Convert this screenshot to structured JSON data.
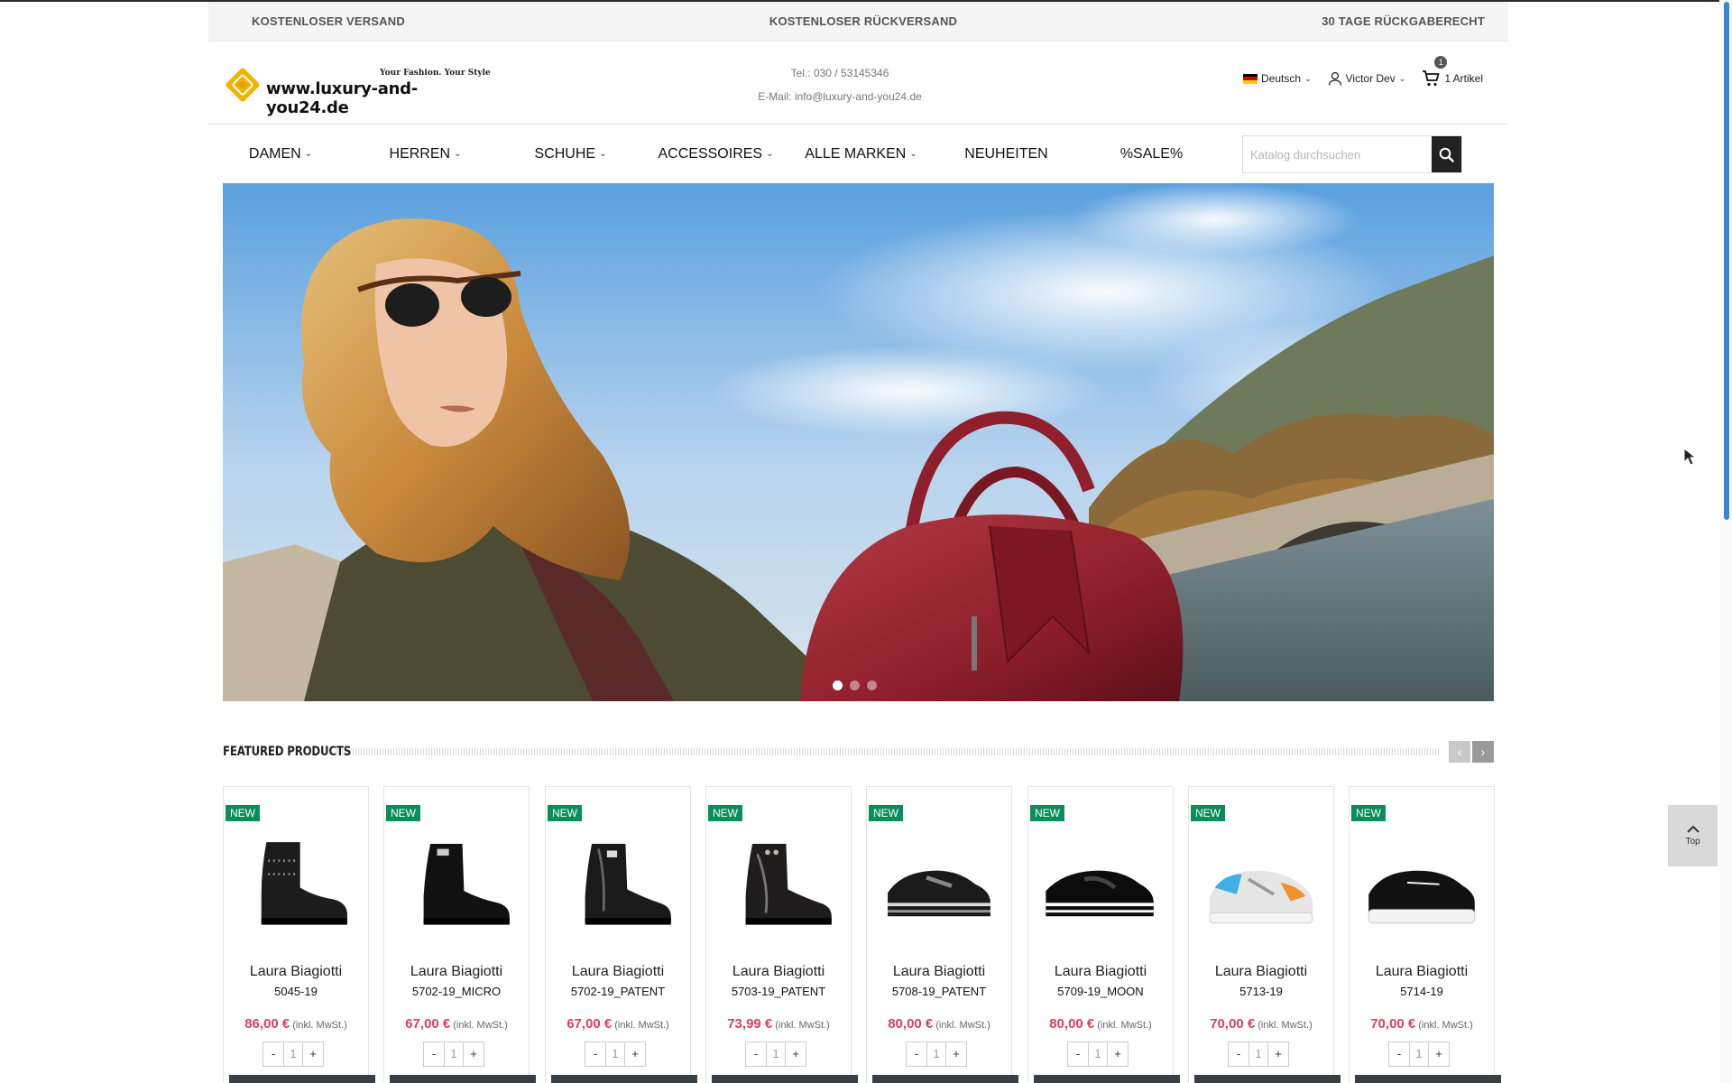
{
  "promo": {
    "left": "KOSTENLOSER VERSAND",
    "center": "KOSTENLOSER RÜCKVERSAND",
    "right": "30 TAGE RÜCKGABERECHT"
  },
  "header": {
    "logo_tagline": "Your Fashion. Your Style",
    "logo_text": "www.luxury-and-you24.de",
    "phone": "Tel.: 030 / 53145346",
    "email": "E-Mail: info@luxury-and-you24.de",
    "language": "Deutsch",
    "user": "Victor Dev",
    "cart_count": "1",
    "cart_label": "1 Artikel"
  },
  "nav": {
    "items": [
      {
        "label": "DAMEN",
        "dropdown": true
      },
      {
        "label": "HERREN",
        "dropdown": true
      },
      {
        "label": "SCHUHE",
        "dropdown": true
      },
      {
        "label": "ACCESSOIRES",
        "dropdown": true
      },
      {
        "label": "ALLE MARKEN",
        "dropdown": true
      },
      {
        "label": "NEUHEITEN",
        "dropdown": false
      },
      {
        "label": "%SALE%",
        "dropdown": false
      }
    ],
    "search_placeholder": "Katalog durchsuchen"
  },
  "featured": {
    "title": "FEATURED PRODUCTS",
    "products": [
      {
        "badge": "NEW",
        "brand": "Laura Biagiotti",
        "model": "5045-19",
        "price": "86,00 €",
        "tax": "(inkl. MwSt.)",
        "qty": "1",
        "type": "boot-studs"
      },
      {
        "badge": "NEW",
        "brand": "Laura Biagiotti",
        "model": "5702-19_MICRO",
        "price": "67,00 €",
        "tax": "(inkl. MwSt.)",
        "qty": "1",
        "type": "boot-matte"
      },
      {
        "badge": "NEW",
        "brand": "Laura Biagiotti",
        "model": "5702-19_PATENT",
        "price": "67,00 €",
        "tax": "(inkl. MwSt.)",
        "qty": "1",
        "type": "boot-patent"
      },
      {
        "badge": "NEW",
        "brand": "Laura Biagiotti",
        "model": "5703-19_PATENT",
        "price": "73,99 €",
        "tax": "(inkl. MwSt.)",
        "qty": "1",
        "type": "boot-patent2"
      },
      {
        "badge": "NEW",
        "brand": "Laura Biagiotti",
        "model": "5708-19_PATENT",
        "price": "80,00 €",
        "tax": "(inkl. MwSt.)",
        "qty": "1",
        "type": "sneaker-patent"
      },
      {
        "badge": "NEW",
        "brand": "Laura Biagiotti",
        "model": "5709-19_MOON",
        "price": "80,00 €",
        "tax": "(inkl. MwSt.)",
        "qty": "1",
        "type": "sneaker-black"
      },
      {
        "badge": "NEW",
        "brand": "Laura Biagiotti",
        "model": "5713-19",
        "price": "70,00 €",
        "tax": "(inkl. MwSt.)",
        "qty": "1",
        "type": "sneaker-color"
      },
      {
        "badge": "NEW",
        "brand": "Laura Biagiotti",
        "model": "5714-19",
        "price": "70,00 €",
        "tax": "(inkl. MwSt.)",
        "qty": "1",
        "type": "sneaker-chunky"
      }
    ]
  },
  "qty_minus": "-",
  "qty_plus": "+",
  "back_to_top": "Top",
  "colors": {
    "price": "#d9435b",
    "badge": "#0a8f5b",
    "scrollbar": "#3a86d8"
  }
}
